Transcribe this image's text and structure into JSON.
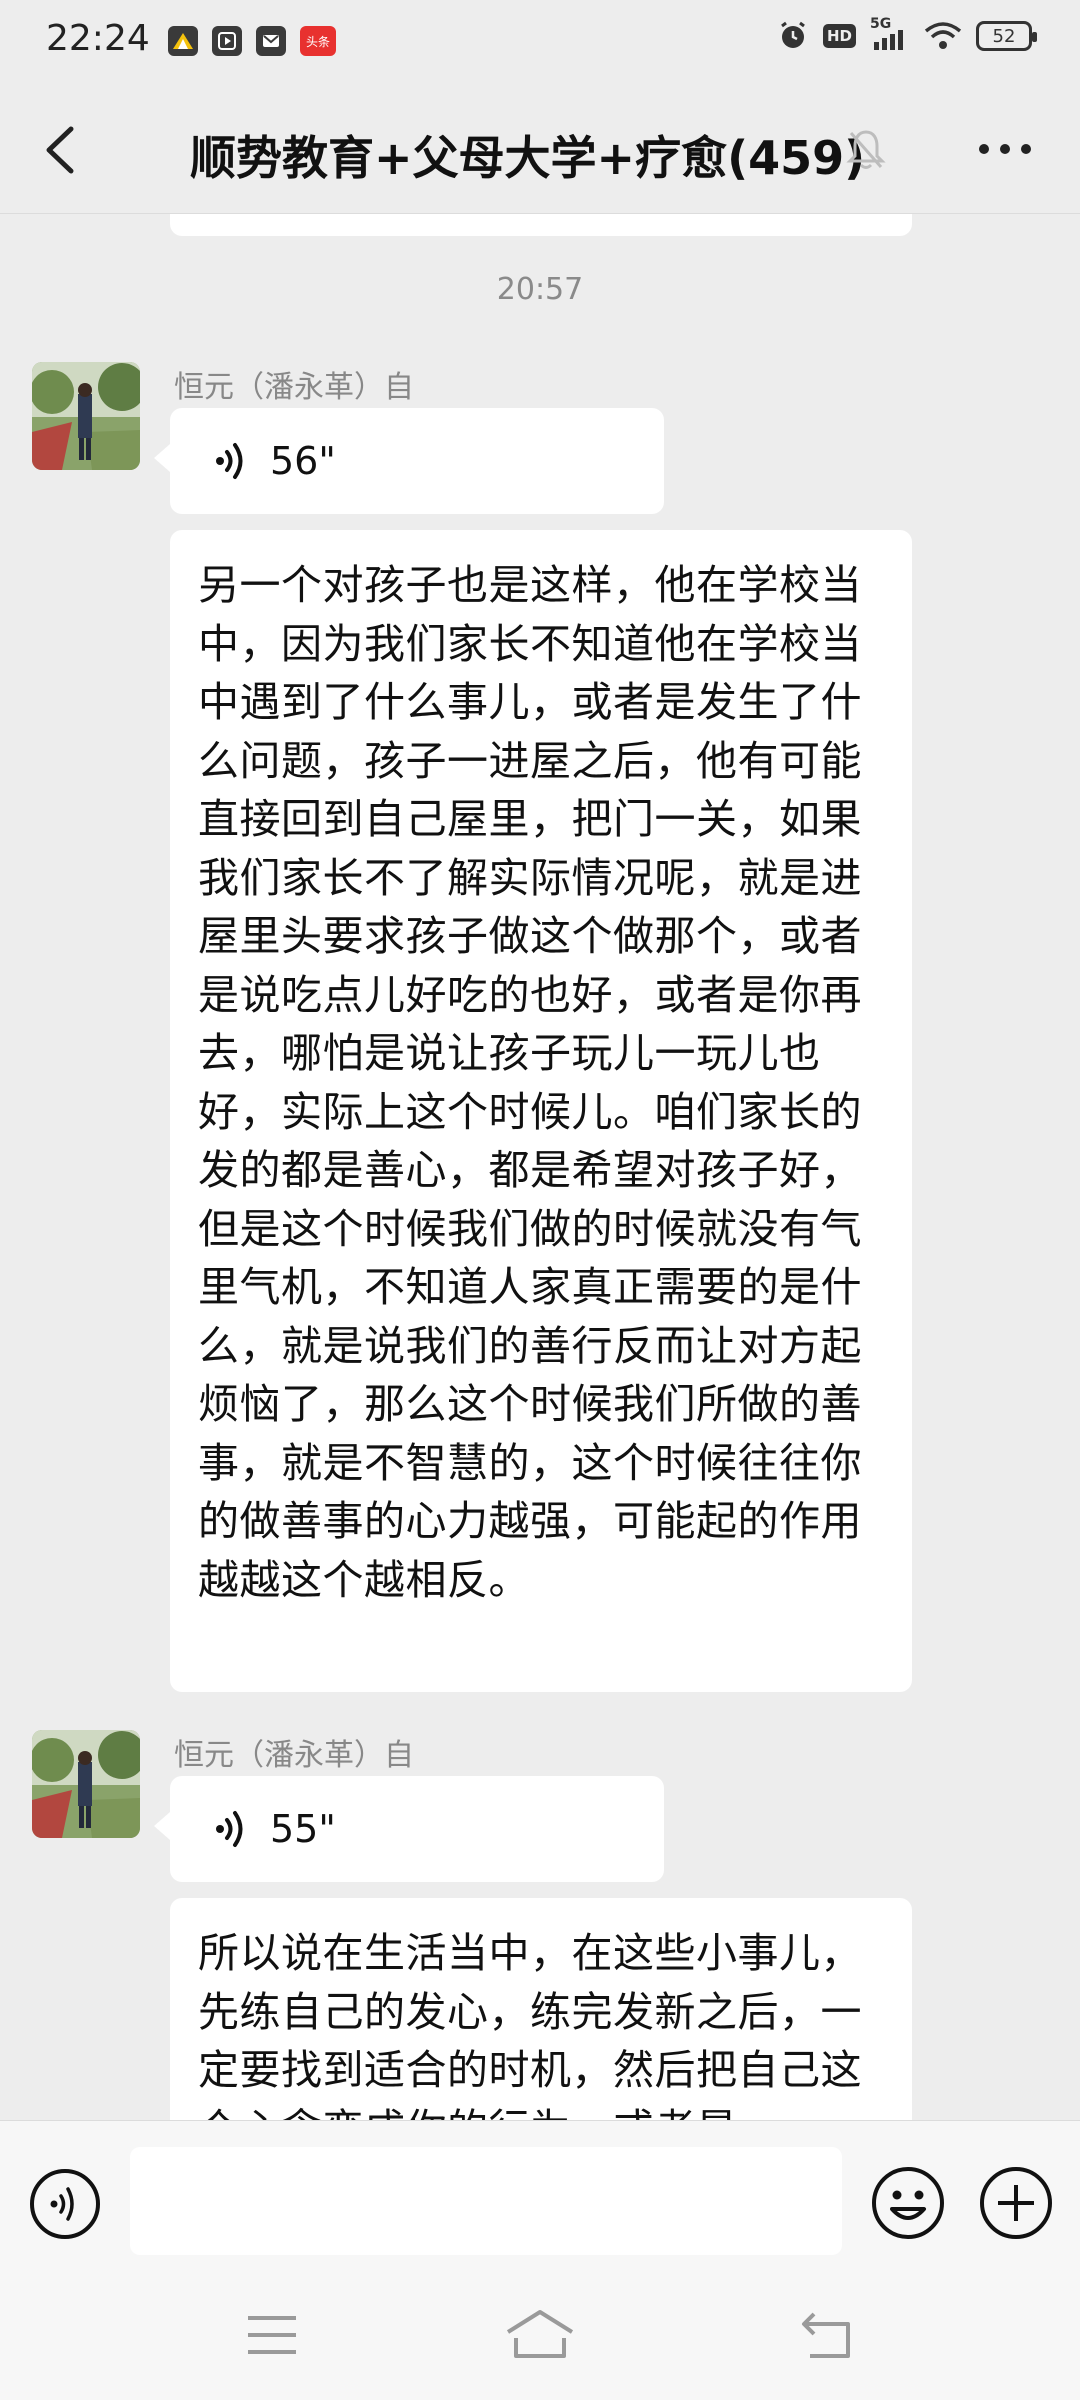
{
  "status_bar": {
    "time": "22:24",
    "app_icons": [
      "notification-app-icon",
      "video-app-icon",
      "mail-app-icon",
      "toutiao-app-icon"
    ],
    "toutiao_label": "头条",
    "network": "5G",
    "hd_label": "HD",
    "battery": "52"
  },
  "header": {
    "title": "顺势教育+父母大学+疗愈(459)",
    "muted": true
  },
  "chat": {
    "timestamp": "20:57",
    "messages": [
      {
        "sender": "恒元（潘永革）自",
        "voice_duration": "56\"",
        "text": "另一个对孩子也是这样，他在学校当中，因为我们家长不知道他在学校当中遇到了什么事儿，或者是发生了什么问题，孩子一进屋之后，他有可能直接回到自己屋里，把门一关，如果我们家长不了解实际情况呢，就是进屋里头要求孩子做这个做那个，或者是说吃点儿好吃的也好，或者是你再去，哪怕是说让孩子玩儿一玩儿也好，实际上这个时候儿。咱们家长的发的都是善心，都是希望对孩子好，但是这个时候我们做的时候就没有气里气机，不知道人家真正需要的是什么，就是说我们的善行反而让对方起烦恼了，那么这个时候我们所做的善事，就是不智慧的，这个时候往往你的做善事的心力越强，可能起的作用越越这个越相反。"
      },
      {
        "sender": "恒元（潘永革）自",
        "voice_duration": "55\"",
        "text": "所以说在生活当中，在这些小事儿，先练自己的发心，练完发新之后，一定要找到适合的时机，然后把自己这个心念变成你的行为，或者是"
      }
    ]
  },
  "input": {
    "value": "",
    "placeholder": ""
  },
  "colors": {
    "background": "#ededed",
    "bubble": "#ffffff",
    "muted_text": "#888888"
  }
}
